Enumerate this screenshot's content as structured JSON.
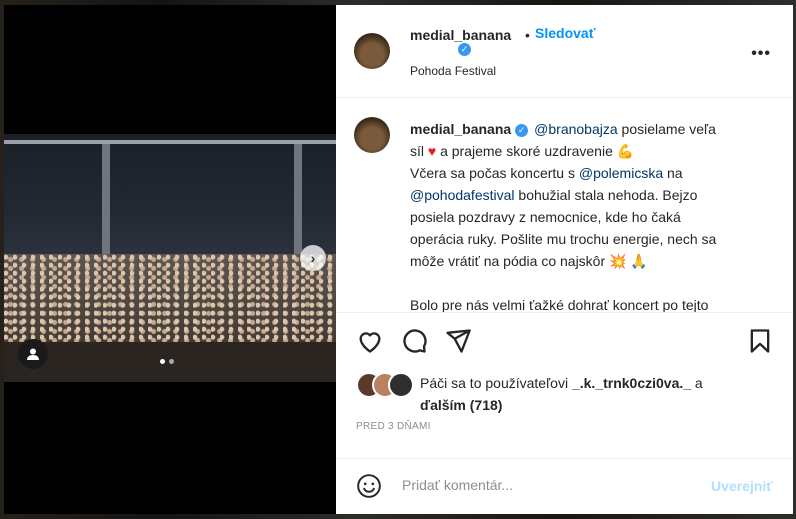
{
  "post": {
    "username": "medial_banana",
    "follow_label": "Sledovať",
    "dot": "•",
    "location": "Pohoda Festival",
    "more_icon": "more-options-icon",
    "caption": {
      "username": "medial_banana",
      "lines": [
        {
          "parts": [
            {
              "t": "@branobajza",
              "m": true
            },
            {
              "t": " posielame veľa"
            }
          ]
        },
        {
          "parts": [
            {
              "t": "síl "
            },
            {
              "t": "♥",
              "h": true
            },
            {
              "t": " a prajeme skoré uzdravenie 💪"
            }
          ]
        },
        {
          "parts": [
            {
              "t": "Včera sa počas koncertu s "
            },
            {
              "t": "@polemicska",
              "m": true
            },
            {
              "t": " na"
            }
          ]
        },
        {
          "parts": [
            {
              "t": "@pohodafestival",
              "m": true
            },
            {
              "t": " bohužial stala nehoda. Bejzo"
            }
          ]
        },
        {
          "parts": [
            {
              "t": "posiela pozdravy z nemocnice, kde ho čaká"
            }
          ]
        },
        {
          "parts": [
            {
              "t": "operácia ruky. Pošlite mu trochu energie, nech sa"
            }
          ]
        },
        {
          "parts": [
            {
              "t": "môže vrátiť na pódia co najskôr 💥 🙏"
            }
          ]
        },
        {
          "parts": [
            {
              "t": " "
            }
          ]
        },
        {
          "parts": [
            {
              "t": "Bolo pre nás velmi ťažké dohrať koncert po tejto"
            }
          ]
        }
      ]
    },
    "likes_text_prefix": "Páči sa to používateľovi ",
    "likes_user": "_.k._trnk0czi0va._",
    "likes_and": " a",
    "likes_others": "ďalším (718)",
    "date": "PRED 3 DŇAMI",
    "comment_placeholder": "Pridať komentár...",
    "post_button": "Uverejniť"
  },
  "colors": {
    "accent": "#0095f6",
    "mention": "#00376b",
    "heart": "#e02020",
    "disabled_post": "#b2dffc"
  },
  "carousel": {
    "current": 1,
    "total": 2
  }
}
